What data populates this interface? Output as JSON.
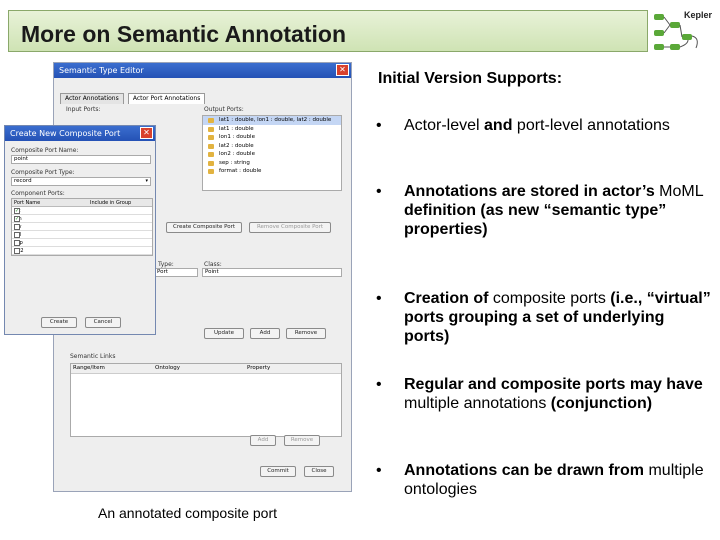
{
  "slide": {
    "title": "More on Semantic Annotation",
    "logo_text": "Kepler",
    "caption": "An annotated composite port"
  },
  "editor": {
    "title": "Semantic Type Editor",
    "close_glyph": "✕",
    "tabs": [
      "Actor Annotations",
      "Actor Port Annotations"
    ],
    "input_ports_label": "Input Ports:",
    "output_ports_label": "Output Ports:",
    "output_ports": [
      {
        "text": "lat1 : double, lon1 : double, lat2 : double",
        "selected": true
      },
      {
        "text": "lat1 : double",
        "selected": false
      },
      {
        "text": "lon1 : double",
        "selected": false
      },
      {
        "text": "lat2 : double",
        "selected": false
      },
      {
        "text": "lon2 : double",
        "selected": false
      },
      {
        "text": "sep : string",
        "selected": false
      },
      {
        "text": "format : double",
        "selected": false
      }
    ],
    "create_composite_label": "Create Composite Port",
    "remove_composite_label": "Remove Composite Port",
    "type_label": "Type:",
    "type_value": "Port",
    "class_label": "Class:",
    "class_value": "Point",
    "add_label": "Add",
    "update_label": "Update",
    "remove_label": "Remove",
    "semantic_links_label": "Semantic Links",
    "semantic_link_columns": [
      "Range/Item",
      "Ontology",
      "Property"
    ],
    "add2_label": "Add",
    "remove2_label": "Remove",
    "commit_label": "Commit",
    "close_label": "Close"
  },
  "composite": {
    "title": "Create New Composite Port",
    "close_glyph": "✕",
    "name_label": "Composite Port Name:",
    "name_value": "point",
    "type_label": "Composite Port Type:",
    "type_value": "record",
    "ports_label": "Component Ports:",
    "columns": [
      "Port Name",
      "Include in Group"
    ],
    "rows": [
      {
        "name": "lat",
        "checked": true
      },
      {
        "name": "lon",
        "checked": true
      },
      {
        "name": "elv",
        "checked": false
      },
      {
        "name": "val",
        "checked": false
      },
      {
        "name": "sep",
        "checked": false
      },
      {
        "name": "lat2",
        "checked": false
      },
      {
        "name": "lon2",
        "checked": false
      }
    ],
    "create_label": "Create",
    "cancel_label": "Cancel"
  },
  "bullets": {
    "heading": "Initial Version Supports:",
    "dot": "•",
    "items": [
      [
        [
          "Actor-level ",
          "normal"
        ],
        [
          "and",
          "bold"
        ],
        [
          " port-level annotations",
          "normal"
        ]
      ],
      [
        [
          "Annotations are stored in actor’s ",
          "bold"
        ],
        [
          "Mo",
          "normal"
        ],
        [
          "ML ",
          "normal"
        ],
        [
          "definition (as new “semantic type” properties)",
          "bold"
        ]
      ],
      [
        [
          "Creation of ",
          "bold"
        ],
        [
          "composite ports",
          "normal"
        ],
        [
          " (i.e., “virtual” ports grouping a set of underlying ports)",
          "bold"
        ]
      ],
      [
        [
          "Regular and composite ports may have ",
          "bold"
        ],
        [
          "multiple annotations",
          "normal"
        ],
        [
          " (conjunction)",
          "bold"
        ]
      ],
      [
        [
          "Annotations can be drawn from ",
          "bold"
        ],
        [
          "multiple ontologies",
          "normal"
        ]
      ]
    ]
  },
  "colors": {
    "title_bg": "#d9eac4",
    "window_title": "#2451b5",
    "close_button": "#d8412d"
  }
}
